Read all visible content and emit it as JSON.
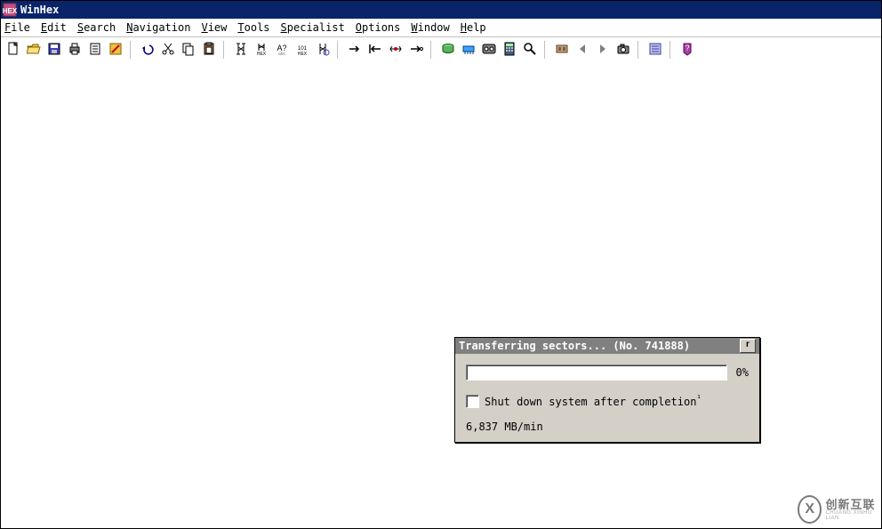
{
  "app": {
    "title": "WinHex"
  },
  "menu": [
    {
      "accel": "F",
      "rest": "ile"
    },
    {
      "accel": "E",
      "rest": "dit"
    },
    {
      "accel": "S",
      "rest": "earch"
    },
    {
      "accel": "N",
      "rest": "avigation"
    },
    {
      "accel": "V",
      "rest": "iew"
    },
    {
      "accel": "T",
      "rest": "ools"
    },
    {
      "accel": "S",
      "rest_pre": "",
      "rest": "pecialist"
    },
    {
      "accel": "O",
      "rest": "ptions"
    },
    {
      "accel": "W",
      "rest": "indow"
    },
    {
      "accel": "H",
      "rest": "elp"
    }
  ],
  "toolbar_icons": [
    "new-icon",
    "open-icon",
    "save-icon",
    "print-icon",
    "properties-icon",
    "write-icon",
    "SEP",
    "undo-icon",
    "cut-icon",
    "copy-icon",
    "paste-icon",
    "SEP",
    "find-icon",
    "find-hex-icon",
    "find-text-icon",
    "replace-hex-icon",
    "find-again-icon",
    "SEP",
    "go-icon",
    "back-icon",
    "marker-icon",
    "forward-icon",
    "SEP",
    "disk-icon",
    "ram-icon",
    "tape-icon",
    "calculator-icon",
    "analyze-icon",
    "SEP",
    "tool-general-icon",
    "prev-icon",
    "next-icon",
    "capture-icon",
    "SEP",
    "options-general-icon",
    "SEP",
    "help-icon"
  ],
  "dialog": {
    "title": "Transferring sectors...  (No. 741888)",
    "percent": "0%",
    "checkbox_label": "Shut down system after completion",
    "footnote_mark": "¹",
    "rate": "6,837 MB/min"
  },
  "watermark": {
    "logo_letter": "X",
    "main": "创新互联",
    "sub": "CHUANG XINHU LIAN"
  }
}
